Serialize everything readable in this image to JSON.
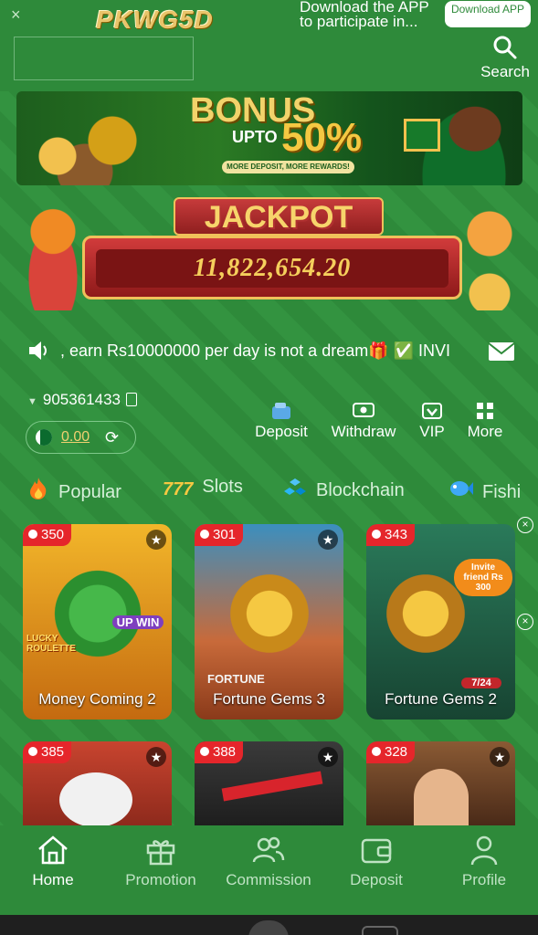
{
  "header": {
    "close": "×",
    "logo": "PKWG5D",
    "download_text": "Download the APP to participate in...",
    "download_button": "Download APP",
    "search_label": "Search"
  },
  "bonus_banner": {
    "title": "BONUS",
    "upto": "UPTO",
    "percent": "50%",
    "subtitle": "MORE DEPOSIT, MORE REWARDS!"
  },
  "jackpot": {
    "title": "JACKPOT",
    "amount": "11,822,654.20"
  },
  "marquee": {
    "text": ", earn Rs10000000 per day is not a dream🎁 ✅ INVI"
  },
  "account": {
    "id": "905361433",
    "balance": "0.00"
  },
  "actions": [
    {
      "label": "Deposit",
      "icon": "wallet-icon"
    },
    {
      "label": "Withdraw",
      "icon": "atm-icon"
    },
    {
      "label": "VIP",
      "icon": "vip-icon"
    },
    {
      "label": "More",
      "icon": "grid-icon"
    }
  ],
  "tabs": [
    {
      "label": "Popular",
      "icon": "fire-icon"
    },
    {
      "label": "Slots",
      "icon": "777-icon"
    },
    {
      "label": "Blockchain",
      "icon": "blockchain-icon"
    },
    {
      "label": "Fishi",
      "icon": "fish-icon"
    }
  ],
  "games": [
    {
      "name": "Money Coming 2",
      "players": "350",
      "bg": "#e8a422",
      "art": "#3fae3b"
    },
    {
      "name": "Fortune Gems 3",
      "players": "301",
      "bg": "#c76a3a",
      "art": "#d7a028"
    },
    {
      "name": "Fortune Gems 2",
      "players": "343",
      "bg": "#1e5e46",
      "art": "#d4a12a"
    },
    {
      "name": "",
      "players": "385",
      "bg": "#b83a2a",
      "art": "#f1f1f1"
    },
    {
      "name": "",
      "players": "388",
      "bg": "#2a2a2a",
      "art": "#d8242c"
    },
    {
      "name": "",
      "players": "328",
      "bg": "#7a4a2a",
      "art": "#e6b58c"
    }
  ],
  "game_overlay_texts": {
    "lucky": "LUCKY ROULETTE",
    "upwin": "UP WIN",
    "fortune": "FORTUNE",
    "invite": "Invite friend Rs 300",
    "time": "7/24"
  },
  "nav": [
    {
      "label": "Home",
      "active": true
    },
    {
      "label": "Promotion",
      "active": false
    },
    {
      "label": "Commission",
      "active": false
    },
    {
      "label": "Deposit",
      "active": false
    },
    {
      "label": "Profile",
      "active": false
    }
  ]
}
